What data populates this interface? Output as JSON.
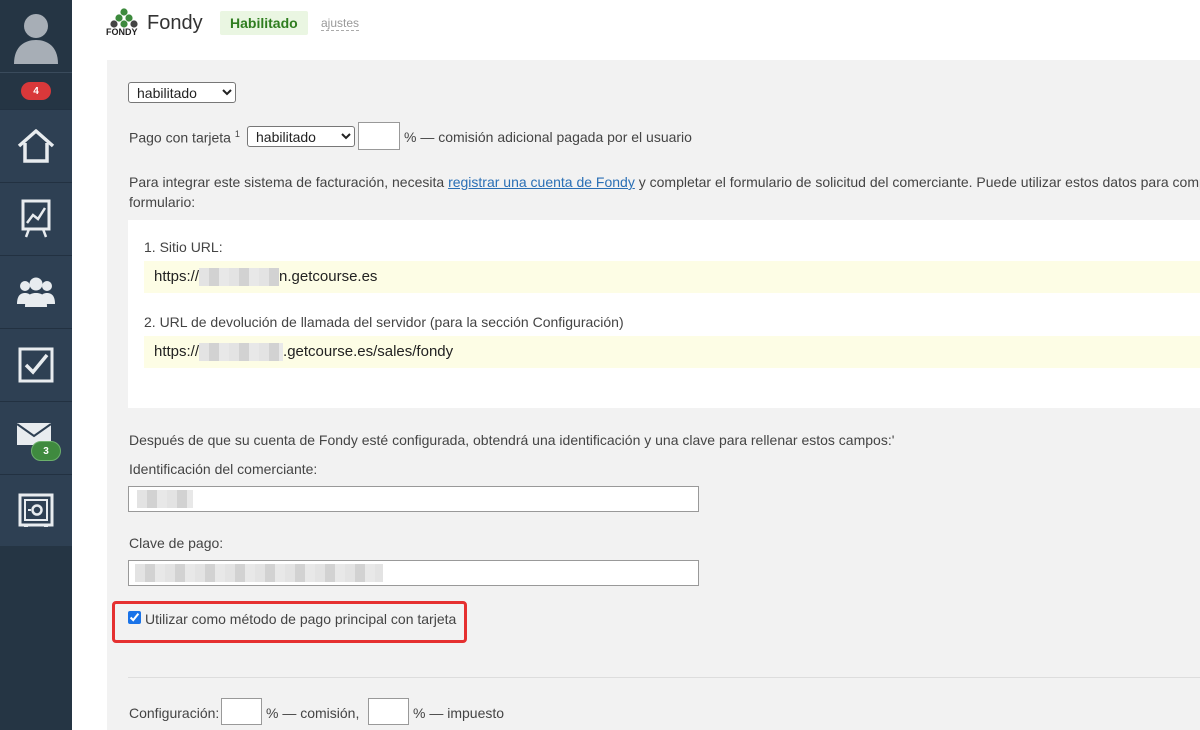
{
  "sidebar": {
    "notifications_badge": "4",
    "messages_badge": "3",
    "items": [
      {
        "icon": "home-icon"
      },
      {
        "icon": "chart-icon"
      },
      {
        "icon": "users-icon"
      },
      {
        "icon": "tasks-icon"
      },
      {
        "icon": "mail-icon"
      },
      {
        "icon": "safe-icon"
      }
    ]
  },
  "header": {
    "logo_text": "FONDY",
    "title": "Fondy",
    "status": "Habilitado",
    "settings_link": "ajustes"
  },
  "form": {
    "main_select": {
      "value": "habilitado",
      "options": [
        "habilitado"
      ]
    },
    "card_payment": {
      "label": "Pago con tarjeta",
      "sup": "1",
      "select_value": "habilitado",
      "percent_value": "",
      "suffix": "% — comisión adicional pagada por el usuario"
    },
    "info_before": "Para integrar este sistema de facturación, necesita ",
    "info_link": "registrar una cuenta de Fondy",
    "info_after": " y completar el formulario de solicitud del comerciante. Puede utilizar estos datos para comp",
    "info_line2": "formulario:",
    "urls": {
      "site_label": "1. Sitio URL:",
      "site_prefix": "https://",
      "site_suffix": "n.getcourse.es",
      "callback_label": "2. URL de devolución de llamada del servidor (para la sección Configuración)",
      "callback_prefix": "https://",
      "callback_suffix": ".getcourse.es/sales/fondy"
    },
    "after_config_text": "Después de que su cuenta de Fondy esté configurada, obtendrá una identificación y una clave para rellenar estos campos:'",
    "merchant_id_label": "Identificación del comerciante:",
    "payment_key_label": "Clave de pago:",
    "primary_method_label": "Utilizar como método de pago principal con tarjeta",
    "primary_method_checked": true,
    "config": {
      "label": "Configuración:",
      "commission_suffix": "% — comisión,",
      "tax_suffix": "% — impuesto"
    }
  },
  "colors": {
    "sidebar": "#2e3e50",
    "accent_link": "#2a6fb5",
    "status_green": "#2f7d1f",
    "highlight_red": "#e53030"
  }
}
